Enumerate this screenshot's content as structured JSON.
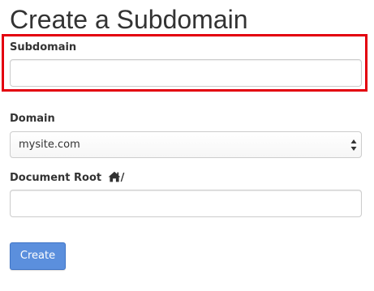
{
  "page": {
    "title": "Create a Subdomain"
  },
  "form": {
    "subdomain": {
      "label": "Subdomain",
      "value": "",
      "placeholder": "",
      "highlighted": true,
      "highlight_color": "#e3000f"
    },
    "domain": {
      "label": "Domain",
      "selected": "mysite.com",
      "icon": "select-updown-arrows-icon"
    },
    "document_root": {
      "label": "Document Root",
      "label_suffix": "/",
      "label_icon": "home-icon",
      "value": "",
      "placeholder": ""
    },
    "submit": {
      "label": "Create",
      "color": "#5b8fdd"
    }
  }
}
